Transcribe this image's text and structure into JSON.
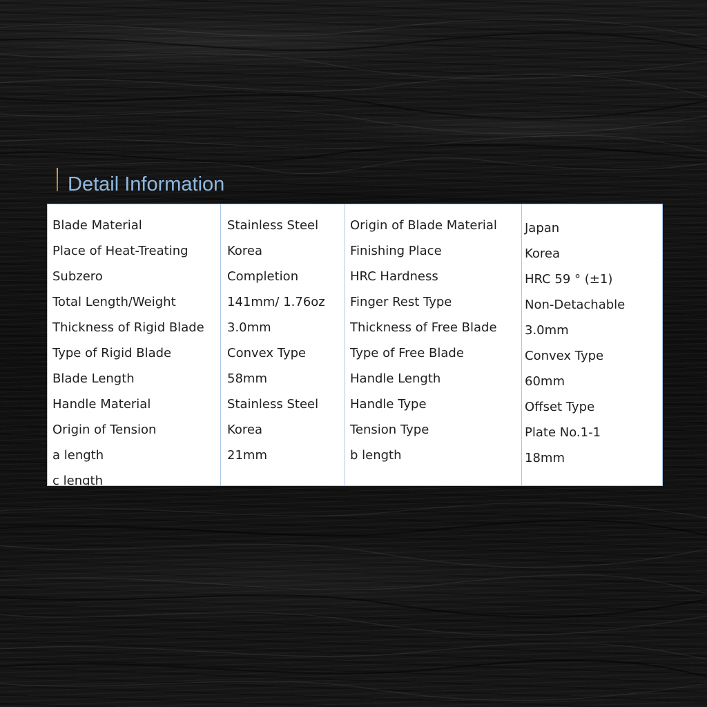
{
  "page": {
    "title": "Detail Information"
  },
  "specs": {
    "col1": [
      "Blade Material",
      "Place of Heat-Treating",
      "Subzero",
      "Total Length/Weight",
      "Thickness of Rigid Blade",
      "Type of Rigid Blade",
      "Blade Length",
      "Handle Material",
      "Origin of Tension",
      "a length",
      "c length"
    ],
    "col2": [
      "Stainless Steel",
      "Korea",
      "Completion",
      "141mm/ 1.76oz",
      "3.0mm",
      "Convex Type",
      "58mm",
      "Stainless Steel",
      "Korea",
      "21mm"
    ],
    "col3": [
      "Origin of Blade Material",
      "Finishing Place",
      "HRC Hardness",
      "Finger Rest Type",
      "Thickness of Free Blade",
      "Type of Free Blade",
      "Handle Length",
      "Handle Type",
      "Tension Type",
      "b length"
    ],
    "col4": [
      "Japan",
      "Korea",
      "HRC 59 ° (±1)",
      "Non-Detachable",
      "3.0mm",
      "Convex Type",
      "60mm",
      "Offset Type",
      "Plate No.1-1",
      "18mm"
    ]
  },
  "colors": {
    "title": "#8fb8e0",
    "accent_marker": "#e0a640",
    "panel_border": "#a9c7e6",
    "panel_bg": "#ffffff",
    "text": "#1f1f1f",
    "background": "#141414"
  }
}
